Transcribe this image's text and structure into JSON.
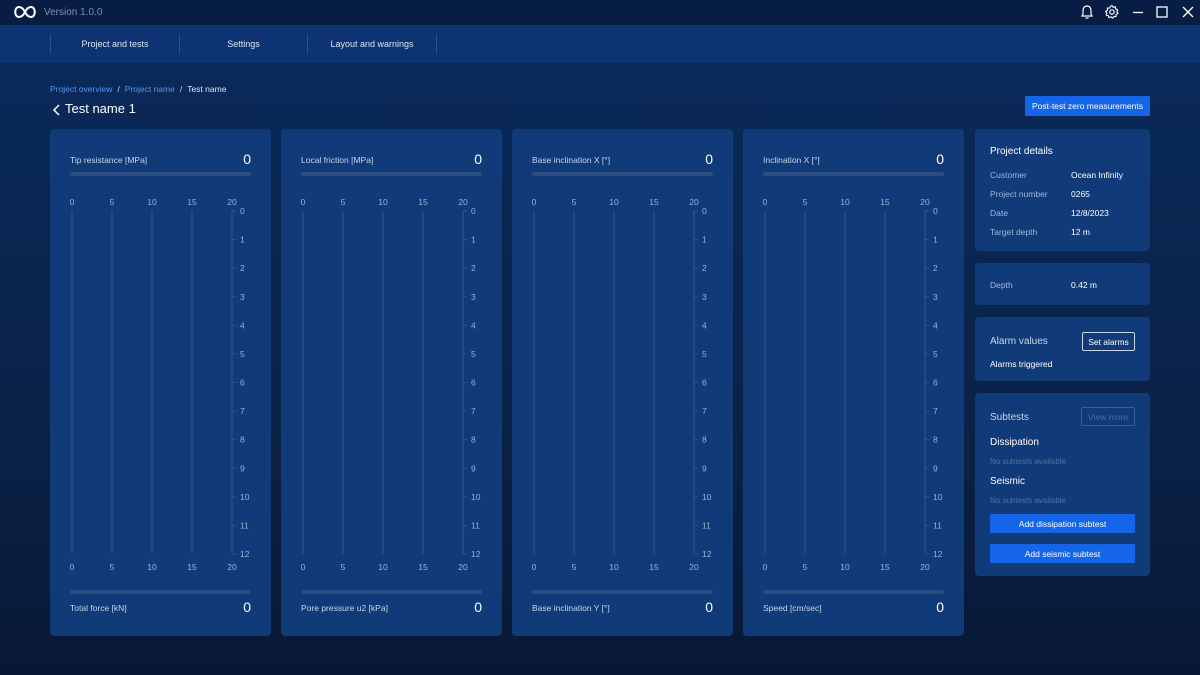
{
  "titlebar": {
    "version": "Version 1.0.0",
    "icons": [
      "infinity-logo-icon",
      "bell-icon",
      "gear-icon",
      "minimize-icon",
      "maximize-icon",
      "close-icon"
    ]
  },
  "nav": {
    "items": [
      {
        "label": "Project and tests"
      },
      {
        "label": "Settings"
      },
      {
        "label": "Layout and warnings"
      }
    ]
  },
  "breadcrumb": {
    "items": [
      "Project overview",
      "Project name",
      "Test name"
    ]
  },
  "page": {
    "title": "Test name 1",
    "post_test_button": "Post-test zero measurements"
  },
  "charts": [
    {
      "top_label": "Tip resistance [MPa]",
      "top_value": "0",
      "bottom_label": "Total force [kN]",
      "bottom_value": "0"
    },
    {
      "top_label": "Local friction [MPa]",
      "top_value": "0",
      "bottom_label": "Pore pressure u2 [kPa]",
      "bottom_value": "0"
    },
    {
      "top_label": "Base inclination X [°]",
      "top_value": "0",
      "bottom_label": "Base inclination Y [°]",
      "bottom_value": "0"
    },
    {
      "top_label": "Inclination  X [°]",
      "top_value": "0",
      "bottom_label": "Speed [cm/sec]",
      "bottom_value": "0"
    }
  ],
  "chart_data": [
    {
      "type": "line",
      "xlabel": "Tip resistance [MPa]",
      "x_ticks": [
        0,
        5,
        10,
        15,
        20
      ],
      "y_ticks": [
        0,
        1,
        2,
        3,
        4,
        5,
        6,
        7,
        8,
        9,
        10,
        11,
        12
      ],
      "xlim": [
        0,
        20
      ],
      "ylim": [
        0,
        12
      ],
      "y_inverted": true,
      "grid": true,
      "series": []
    },
    {
      "type": "line",
      "xlabel": "Local friction [MPa]",
      "x_ticks": [
        0,
        5,
        10,
        15,
        20
      ],
      "y_ticks": [
        0,
        1,
        2,
        3,
        4,
        5,
        6,
        7,
        8,
        9,
        10,
        11,
        12
      ],
      "xlim": [
        0,
        20
      ],
      "ylim": [
        0,
        12
      ],
      "y_inverted": true,
      "grid": true,
      "series": []
    },
    {
      "type": "line",
      "xlabel": "Base inclination X [°]",
      "x_ticks": [
        0,
        5,
        10,
        15,
        20
      ],
      "y_ticks": [
        0,
        1,
        2,
        3,
        4,
        5,
        6,
        7,
        8,
        9,
        10,
        11,
        12
      ],
      "xlim": [
        0,
        20
      ],
      "ylim": [
        0,
        12
      ],
      "y_inverted": true,
      "grid": true,
      "series": []
    },
    {
      "type": "line",
      "xlabel": "Inclination  X [°]",
      "x_ticks": [
        0,
        5,
        10,
        15,
        20
      ],
      "y_ticks": [
        0,
        1,
        2,
        3,
        4,
        5,
        6,
        7,
        8,
        9,
        10,
        11,
        12
      ],
      "xlim": [
        0,
        20
      ],
      "ylim": [
        0,
        12
      ],
      "y_inverted": true,
      "grid": true,
      "series": []
    }
  ],
  "project_details": {
    "title": "Project details",
    "rows": [
      {
        "key": "Customer",
        "value": "Ocean Infinity"
      },
      {
        "key": "Project number",
        "value": "0265"
      },
      {
        "key": "Date",
        "value": "12/8/2023"
      },
      {
        "key": "Target depth",
        "value": "12 m"
      }
    ]
  },
  "depth": {
    "key": "Depth",
    "value": "0.42 m"
  },
  "alarms": {
    "title": "Alarm values",
    "button": "Set alarms",
    "status": "Alarms triggered"
  },
  "subtests": {
    "title": "Subtests",
    "view_more": "View more",
    "dissipation_heading": "Dissipation",
    "dissipation_empty": "No subtests available",
    "seismic_heading": "Seismic",
    "seismic_empty": "No subtests available",
    "add_dissipation": "Add dissipation subtest",
    "add_seismic": "Add seismic subtest"
  },
  "colors": {
    "accent": "#1565e8",
    "link": "#4f97f2",
    "panel": "#103a78",
    "background": "#0a2650"
  }
}
